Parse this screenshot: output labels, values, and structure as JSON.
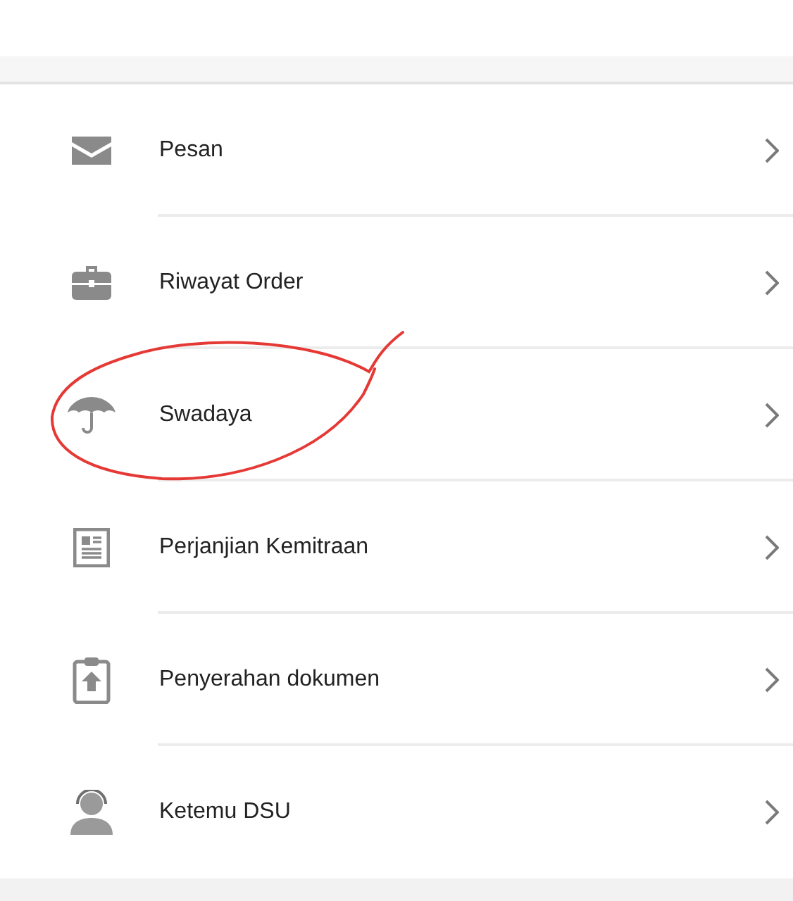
{
  "menu": [
    {
      "label": "Pesan",
      "circled": false
    },
    {
      "label": "Riwayat Order",
      "circled": false
    },
    {
      "label": "Swadaya",
      "circled": true
    },
    {
      "label": "Perjanjian Kemitraan",
      "circled": false
    },
    {
      "label": "Penyerahan dokumen",
      "circled": false
    },
    {
      "label": "Ketemu DSU",
      "circled": false
    }
  ],
  "annotation": {
    "kind": "freehand-loop",
    "color": "#e53935"
  }
}
